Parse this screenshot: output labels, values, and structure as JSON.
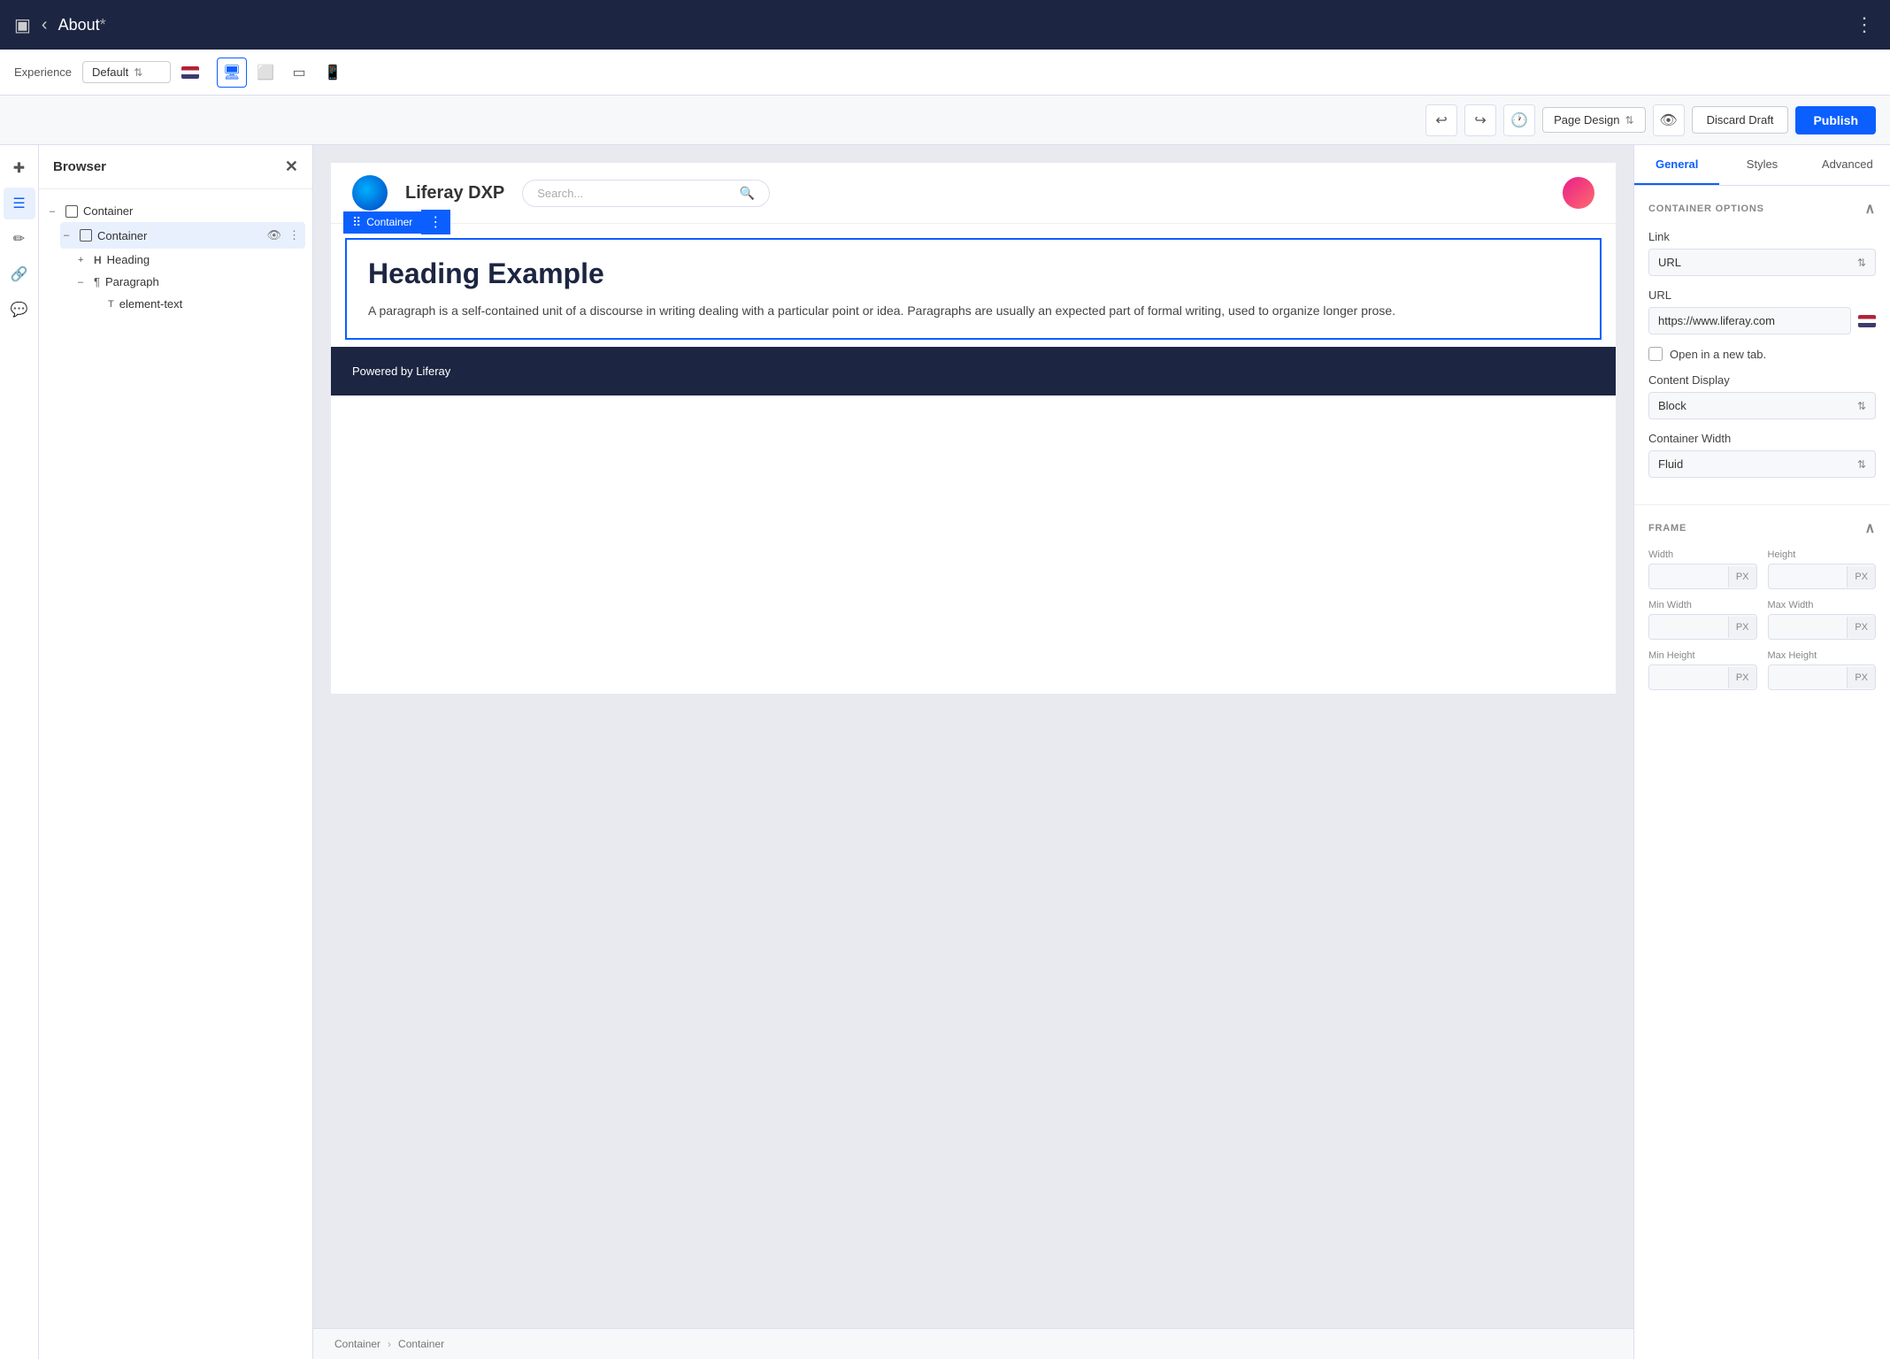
{
  "topbar": {
    "title": "About",
    "asterisk": "*",
    "dots_label": "⋮"
  },
  "experience_bar": {
    "label": "Experience",
    "select_value": "Default",
    "flag_alt": "US Flag"
  },
  "device_modes": [
    "desktop",
    "tablet",
    "wide-mobile",
    "mobile"
  ],
  "toolbar": {
    "undo_label": "↩",
    "redo_label": "↪",
    "history_label": "🕐",
    "page_design_label": "Page Design",
    "discard_label": "Discard Draft",
    "publish_label": "Publish"
  },
  "browser_panel": {
    "title": "Browser",
    "tree": [
      {
        "id": "container-root",
        "level": 0,
        "label": "Container",
        "type": "container",
        "toggle": "–"
      },
      {
        "id": "container-child",
        "level": 1,
        "label": "Container",
        "type": "container",
        "toggle": "–",
        "selected": true,
        "has_actions": true
      },
      {
        "id": "heading",
        "level": 2,
        "label": "Heading",
        "type": "heading",
        "toggle": "+"
      },
      {
        "id": "paragraph",
        "level": 2,
        "label": "Paragraph",
        "type": "paragraph",
        "toggle": "–"
      },
      {
        "id": "element-text",
        "level": 3,
        "label": "element-text",
        "type": "text",
        "toggle": ""
      }
    ]
  },
  "canvas": {
    "brand": "Liferay DXP",
    "search_placeholder": "Search...",
    "container_label": "Container",
    "heading": "Heading Example",
    "paragraph": "A paragraph is a self-contained unit of a discourse in writing dealing with a particular point or idea. Paragraphs are usually an expected part of formal writing, used to organize longer prose.",
    "footer_text": "Powered by Liferay",
    "breadcrumb_root": "Container",
    "breadcrumb_child": "Container"
  },
  "right_panel": {
    "tabs": [
      "General",
      "Styles",
      "Advanced"
    ],
    "active_tab": "General",
    "container_options_label": "CONTAINER OPTIONS",
    "link_label": "Link",
    "link_select": "URL",
    "url_label": "URL",
    "url_value": "https://www.liferay.com",
    "open_new_tab_label": "Open in a new tab.",
    "content_display_label": "Content Display",
    "content_display_value": "Block",
    "container_width_label": "Container Width",
    "container_width_value": "Fluid",
    "frame_label": "FRAME",
    "width_label": "Width",
    "height_label": "Height",
    "width_unit": "PX",
    "height_unit": "PX",
    "min_width_label": "Min Width",
    "max_width_label": "Max Width",
    "min_height_label": "Min Height",
    "max_height_label": "Max Height"
  }
}
